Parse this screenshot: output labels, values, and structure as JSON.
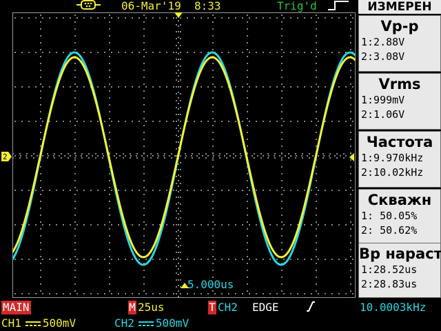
{
  "status": {
    "date": "06-Mar'19",
    "time": "8:33",
    "trigger_state": "Trig'd"
  },
  "icons": {
    "usb": "usb-connector-icon",
    "trigger_shape": "rising-edge-square-icon",
    "slope": "rising-slope-icon",
    "coupling": "dc-coupling-icon"
  },
  "display": {
    "timebase_readout": "5.000us",
    "ch1_color": "#f4f032",
    "ch2_color": "#27d7e6",
    "grid": true
  },
  "measure": {
    "title": "ИЗМЕРЕН",
    "items": [
      {
        "label": "Vp-p",
        "v1": "1:2.88V",
        "v2": "2:3.08V"
      },
      {
        "label": "Vrms",
        "v1": "1:999mV",
        "v2": "2:1.06V"
      },
      {
        "label": "Частота",
        "v1": "1:9.970kHz",
        "v2": "2:10.02kHz"
      },
      {
        "label": "Скважн",
        "v1": "1: 50.05%",
        "v2": "2: 50.62%"
      },
      {
        "label": "Вр нараст",
        "v1": "1:28.52us",
        "v2": "2:28.83us"
      }
    ]
  },
  "bottom": {
    "mode": "MAIN",
    "m_badge": "M",
    "m_value": "25us",
    "t_badge": "T",
    "trigger_source": "CH2",
    "trigger_type": "EDGE",
    "trigger_freq": "10.0003kHz",
    "ch1_label": "CH1",
    "ch1_scale": "500mV",
    "ch2_label": "CH2",
    "ch2_scale": "500mV"
  }
}
